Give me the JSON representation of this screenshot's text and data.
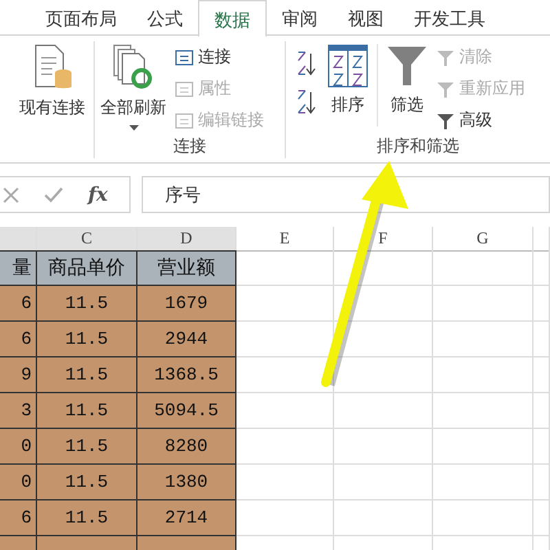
{
  "tabs": [
    {
      "label": "页面布局",
      "selected": false
    },
    {
      "label": "公式",
      "selected": false
    },
    {
      "label": "数据",
      "selected": true
    },
    {
      "label": "审阅",
      "selected": false
    },
    {
      "label": "视图",
      "selected": false
    },
    {
      "label": "开发工具",
      "selected": false
    }
  ],
  "ribbon": {
    "existing_connections": {
      "label": "现有连接"
    },
    "connections_group": {
      "label": "连接",
      "refresh_all": {
        "label": "全部刷新"
      },
      "items": [
        {
          "label": "连接",
          "disabled": false
        },
        {
          "label": "属性",
          "disabled": true
        },
        {
          "label": "编辑链接",
          "disabled": true
        }
      ]
    },
    "sort_filter_group": {
      "label": "排序和筛选",
      "sort": {
        "label": "排序"
      },
      "filter": {
        "label": "筛选"
      },
      "items": [
        {
          "label": "清除",
          "disabled": true
        },
        {
          "label": "重新应用",
          "disabled": true
        },
        {
          "label": "高级",
          "disabled": false
        }
      ]
    }
  },
  "formula_bar": {
    "fx": "fx",
    "value": "序号"
  },
  "sheet": {
    "columns": [
      {
        "selected": true
      },
      {
        "label": "C",
        "selected": true
      },
      {
        "label": "D",
        "selected": true
      },
      {
        "label": "E",
        "selected": false
      },
      {
        "label": "F",
        "selected": false
      },
      {
        "label": "G",
        "selected": false
      }
    ],
    "header_row": [
      "量",
      "商品单价",
      "营业额"
    ],
    "rows": [
      [
        "6",
        "11.5",
        "1679"
      ],
      [
        "6",
        "11.5",
        "2944"
      ],
      [
        "9",
        "11.5",
        "1368.5"
      ],
      [
        "3",
        "11.5",
        "5094.5"
      ],
      [
        "0",
        "11.5",
        "8280"
      ],
      [
        "0",
        "11.5",
        "1380"
      ],
      [
        "6",
        "11.5",
        "2714"
      ]
    ]
  }
}
